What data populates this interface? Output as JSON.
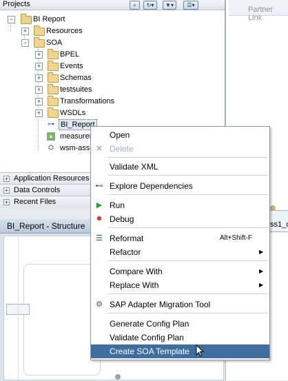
{
  "projects": {
    "title": "Projects",
    "tree": {
      "root": "BI Report",
      "resources": "Resources",
      "soa": "SOA",
      "bpel": "BPEL",
      "events": "Events",
      "schemas": "Schemas",
      "testsuites": "testsuites",
      "transformations": "Transformations",
      "wsdls": "WSDLs",
      "bi_report_file": "BI_Report",
      "measurement_file": "measuren",
      "wsm_file": "wsm-asse"
    }
  },
  "accordion": {
    "app_resources": "Application Resources",
    "data_controls": "Data Controls",
    "recent_files": "Recent Files"
  },
  "structure": {
    "title": "BI_Report - Structure"
  },
  "editor": {
    "partner_links": "Partner Link",
    "component_label": "ss1_c"
  },
  "context_menu": {
    "open": "Open",
    "delete": "Delete",
    "validate_xml": "Validate XML",
    "explore_dependencies": "Explore Dependencies",
    "run": "Run",
    "debug": "Debug",
    "reformat": "Reformat",
    "reformat_shortcut": "Alt+Shift-F",
    "refactor": "Refactor",
    "compare_with": "Compare With",
    "replace_with": "Replace With",
    "sap_adapter": "SAP Adapter Migration Tool",
    "generate_config": "Generate Config Plan",
    "validate_config": "Validate Config Plan",
    "create_soa_template": "Create SOA Template"
  },
  "colors": {
    "selection": "#3d6e9f",
    "folder": "#f2d48a"
  }
}
